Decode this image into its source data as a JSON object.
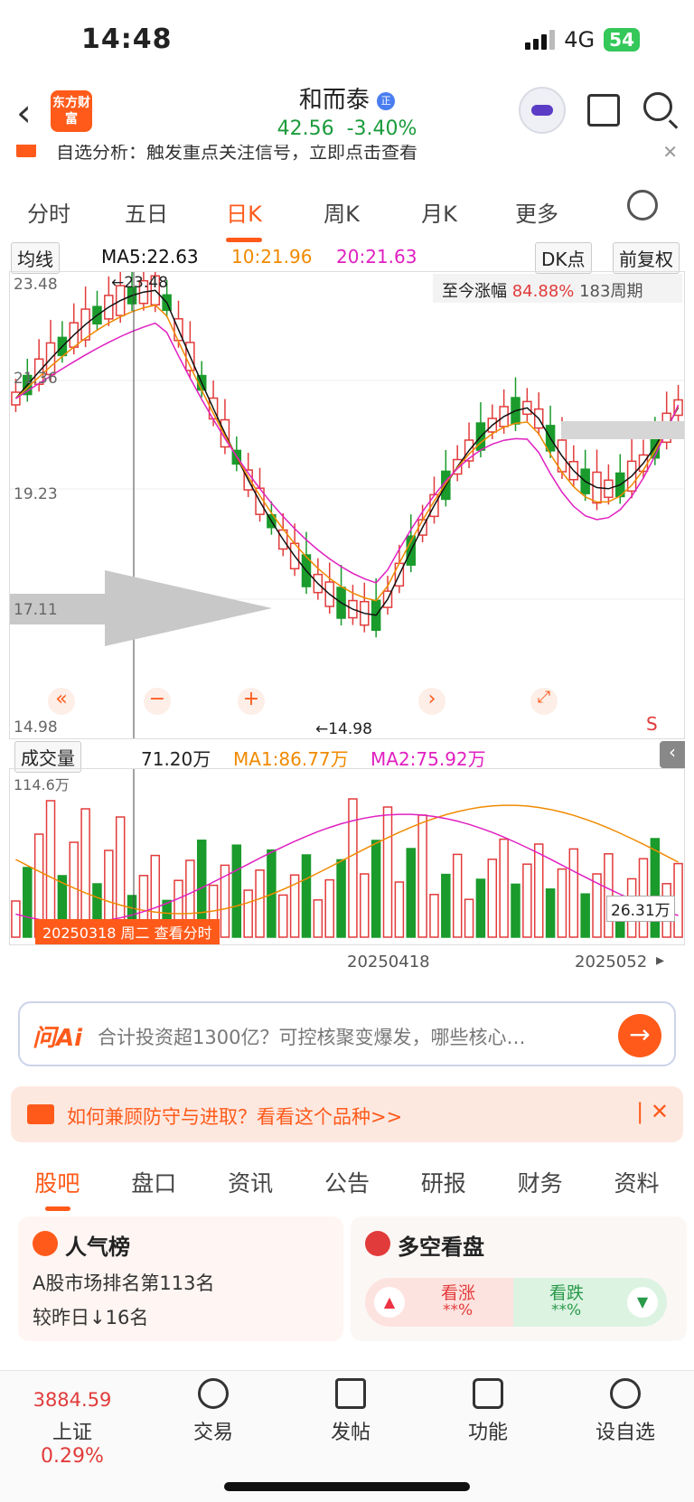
{
  "status": {
    "time": "14:48",
    "network": "4G",
    "battery": "54"
  },
  "header": {
    "logo": "东方财富",
    "title": "和而泰",
    "badge": "正",
    "price": "42.56",
    "change": "-3.40%"
  },
  "ticker": {
    "text": "自选分析：触发重点关注信号，立即点击查看"
  },
  "tabs": [
    "分时",
    "五日",
    "日K",
    "周K",
    "月K",
    "更多"
  ],
  "ma": {
    "selector": "均线",
    "ma5": "MA5:22.63",
    "ma10": "10:21.96",
    "ma20": "20:21.63",
    "dk": "DK点",
    "adjust": "前复权"
  },
  "range": {
    "label": "至今涨幅",
    "value": "84.88%",
    "period": "183周期"
  },
  "axis": {
    "y1": "23.48",
    "y2": "21.36",
    "y3": "19.23",
    "y4": "17.11",
    "y5": "14.98",
    "high_mark": "←23.48",
    "low_mark": "←14.98"
  },
  "volume": {
    "selector": "成交量",
    "vol": "71.20万",
    "ma1": "MA1:86.77万",
    "ma2": "MA2:75.92万",
    "top": "114.6万",
    "current": "26.31万"
  },
  "dates": {
    "tooltip": "20250318 周二 查看分时",
    "mid": "20250418",
    "right": "2025052"
  },
  "ai": {
    "logo": "问Ai",
    "text": "合计投资超1300亿？可控核聚变爆发，哪些核心…"
  },
  "banner": {
    "text": "如何兼顾防守与进取？看看这个品种>>"
  },
  "sub_tabs": [
    "股吧",
    "盘口",
    "资讯",
    "公告",
    "研报",
    "财务",
    "资料"
  ],
  "cards": {
    "popularity": {
      "title": "人气榜",
      "line1": "A股市场排名第113名",
      "line2": "较昨日↓16名"
    },
    "sentiment": {
      "title": "多空看盘",
      "bull": "看涨",
      "bear": "看跌",
      "bull_value": "**%",
      "bear_value": "**%"
    }
  },
  "bottom_nav": {
    "index_value": "3884.59",
    "index_name": "上证",
    "index_change": "0.29%",
    "trade": "交易",
    "post": "发帖",
    "func": "功能",
    "watch": "设自选"
  },
  "colors": {
    "up": "#e23b3b",
    "down": "#1a9b2c",
    "accent": "#ff5a1a",
    "ma5": "#111111",
    "ma10": "#f08a00",
    "ma20": "#e020c0"
  }
}
